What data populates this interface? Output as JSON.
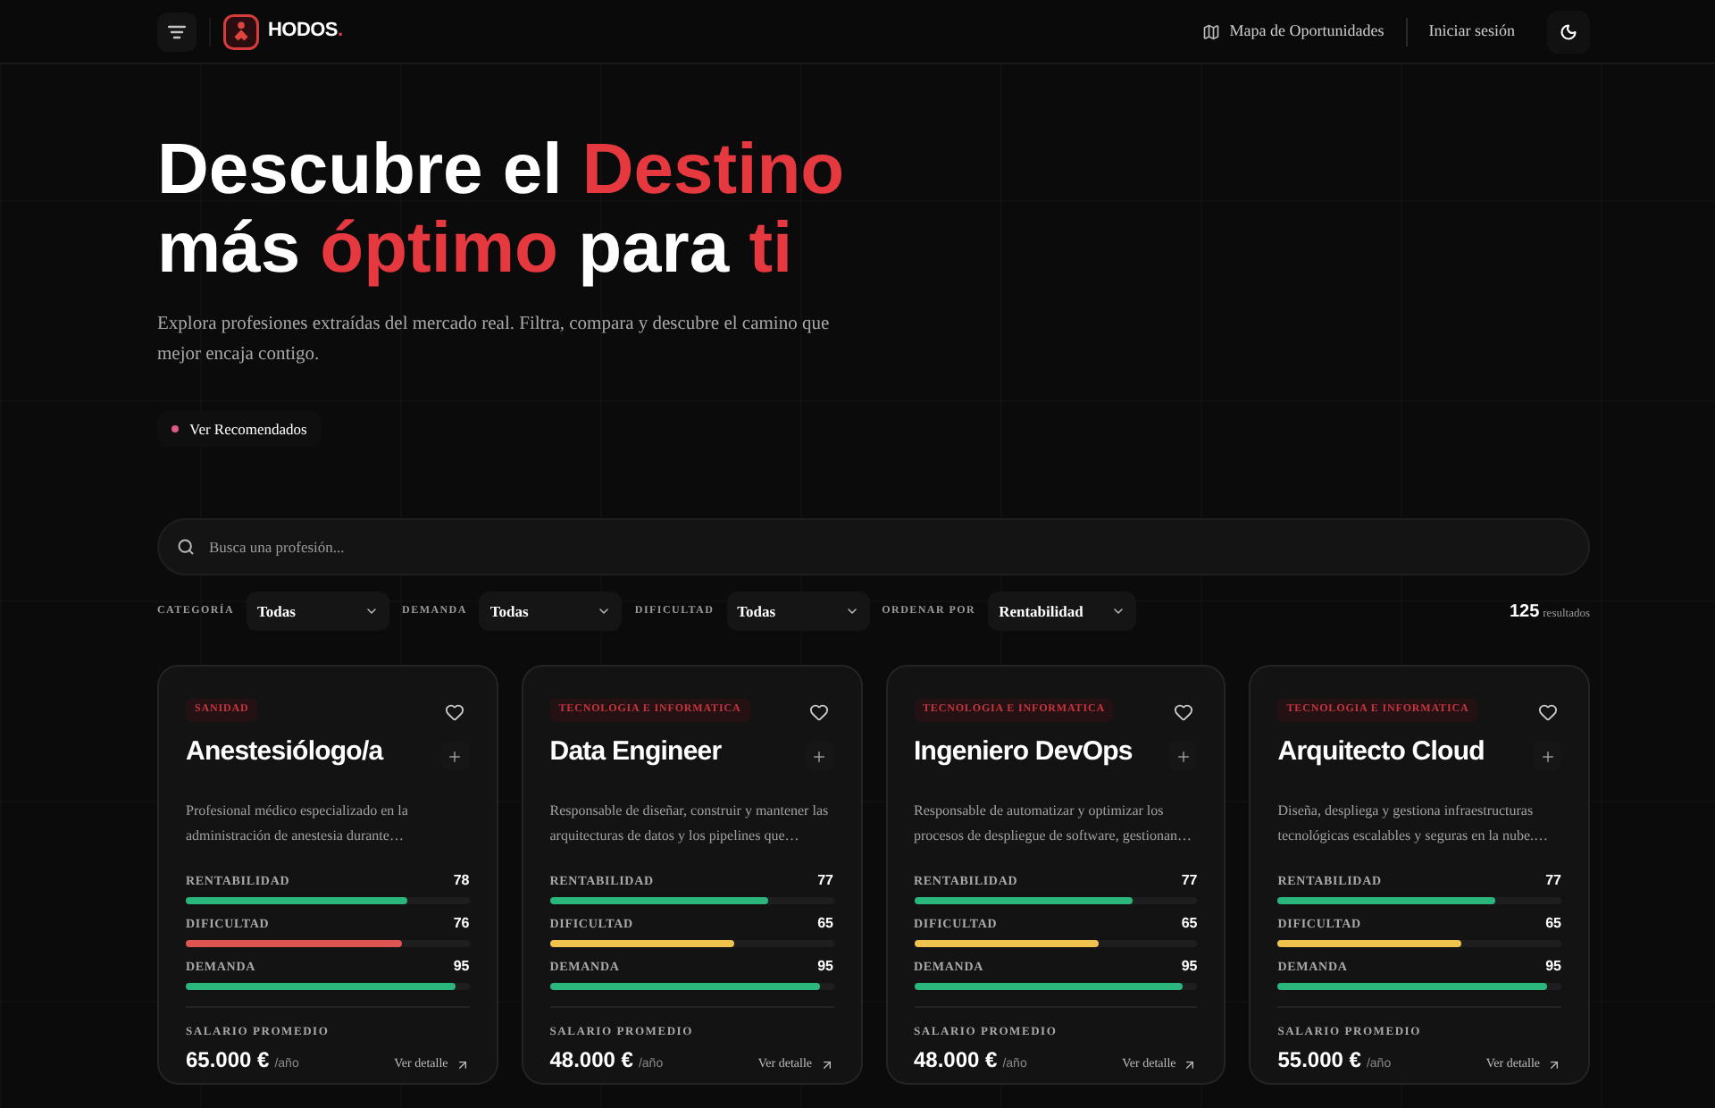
{
  "header": {
    "brand": {
      "name": "HODOS",
      "suffix": "."
    },
    "nav": [
      {
        "label": "Mapa de Oportunidades",
        "kind": "icon"
      },
      {
        "label": "Iniciar sesión",
        "kind": "plain"
      }
    ]
  },
  "hero": {
    "title_lines": [
      [
        {
          "text": "Descubre el ",
          "highlight": false
        },
        {
          "text": "Destino",
          "highlight": true
        }
      ],
      [
        {
          "text": "más ",
          "highlight": false
        },
        {
          "text": "óptimo",
          "highlight": true
        },
        {
          "text": " para ",
          "highlight": false
        },
        {
          "text": "ti",
          "highlight": true
        }
      ]
    ],
    "subtitle": "Explora profesiones extraídas del mercado real. Filtra, compara y descubre el camino que mejor encaja contigo.",
    "cta": "Ver Recomendados"
  },
  "search": {
    "placeholder": "Busca una profesión..."
  },
  "filters": [
    {
      "label": "CATEGORÍA",
      "value": "Todas"
    },
    {
      "label": "DEMANDA",
      "value": "Todas"
    },
    {
      "label": "DIFICULTAD",
      "value": "Todas"
    },
    {
      "label": "ORDENAR POR",
      "value": "Rentabilidad"
    }
  ],
  "results": {
    "count": "125",
    "label": "resultados"
  },
  "cards": [
    {
      "category": "SANIDAD",
      "title": "Anestesiólogo/a",
      "description": "Profesional médico especializado en la administración de anestesia durante…",
      "metrics": [
        {
          "label": "RENTABILIDAD",
          "value": "78",
          "level": 0.78,
          "color": "#2bb67e"
        },
        {
          "label": "DIFICULTAD",
          "value": "76",
          "level": 0.76,
          "color": "#df5450"
        },
        {
          "label": "DEMANDA",
          "value": "95",
          "level": 0.95,
          "color": "#2bb67e"
        }
      ],
      "salary_label": "SALARIO PROMEDIO",
      "salary": "65.000 €",
      "salary_unit": "/año",
      "link": "Ver detalle"
    },
    {
      "category": "TECNOLOGIA E INFORMATICA",
      "title": "Data Engineer",
      "description": "Responsable de diseñar, construir y mantener las arquitecturas de datos y los pipelines que…",
      "metrics": [
        {
          "label": "RENTABILIDAD",
          "value": "77",
          "level": 0.77,
          "color": "#2bb67e"
        },
        {
          "label": "DIFICULTAD",
          "value": "65",
          "level": 0.65,
          "color": "#f0c24e"
        },
        {
          "label": "DEMANDA",
          "value": "95",
          "level": 0.95,
          "color": "#2bb67e"
        }
      ],
      "salary_label": "SALARIO PROMEDIO",
      "salary": "48.000 €",
      "salary_unit": "/año",
      "link": "Ver detalle"
    },
    {
      "category": "TECNOLOGIA E INFORMATICA",
      "title": "Ingeniero DevOps",
      "description": "Responsable de automatizar y optimizar los procesos de despliegue de software, gestionan…",
      "metrics": [
        {
          "label": "RENTABILIDAD",
          "value": "77",
          "level": 0.77,
          "color": "#2bb67e"
        },
        {
          "label": "DIFICULTAD",
          "value": "65",
          "level": 0.65,
          "color": "#f0c24e"
        },
        {
          "label": "DEMANDA",
          "value": "95",
          "level": 0.95,
          "color": "#2bb67e"
        }
      ],
      "salary_label": "SALARIO PROMEDIO",
      "salary": "48.000 €",
      "salary_unit": "/año",
      "link": "Ver detalle"
    },
    {
      "category": "TECNOLOGIA E INFORMATICA",
      "title": "Arquitecto Cloud",
      "description": "Diseña, despliega y gestiona infraestructuras tecnológicas escalables y seguras en la nube.…",
      "metrics": [
        {
          "label": "RENTABILIDAD",
          "value": "77",
          "level": 0.77,
          "color": "#2bb67e"
        },
        {
          "label": "DIFICULTAD",
          "value": "65",
          "level": 0.65,
          "color": "#f0c24e"
        },
        {
          "label": "DEMANDA",
          "value": "95",
          "level": 0.95,
          "color": "#2bb67e"
        }
      ],
      "salary_label": "SALARIO PROMEDIO",
      "salary": "55.000 €",
      "salary_unit": "/año",
      "link": "Ver detalle"
    }
  ]
}
